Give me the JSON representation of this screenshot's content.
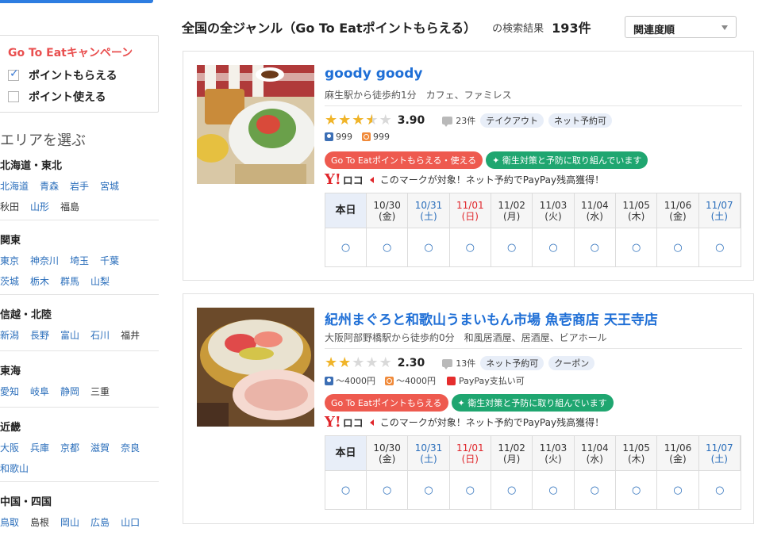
{
  "sidebar": {
    "campaign_title": "Go To Eatキャンペーン",
    "options": [
      {
        "label": "ポイントもらえる",
        "checked": true
      },
      {
        "label": "ポイント使える",
        "checked": false
      }
    ],
    "area_heading": "エリアを選ぶ",
    "regions": [
      {
        "name": "北海道・東北",
        "prefs": [
          {
            "name": "北海道",
            "link": true
          },
          {
            "name": "青森",
            "link": true
          },
          {
            "name": "岩手",
            "link": true
          },
          {
            "name": "宮城",
            "link": true
          },
          {
            "name": "秋田",
            "link": false
          },
          {
            "name": "山形",
            "link": true
          },
          {
            "name": "福島",
            "link": false
          }
        ]
      },
      {
        "name": "関東",
        "prefs": [
          {
            "name": "東京",
            "link": true
          },
          {
            "name": "神奈川",
            "link": true
          },
          {
            "name": "埼玉",
            "link": true
          },
          {
            "name": "千葉",
            "link": true
          },
          {
            "name": "茨城",
            "link": true
          },
          {
            "name": "栃木",
            "link": true
          },
          {
            "name": "群馬",
            "link": true
          },
          {
            "name": "山梨",
            "link": true
          }
        ]
      },
      {
        "name": "信越・北陸",
        "prefs": [
          {
            "name": "新潟",
            "link": true
          },
          {
            "name": "長野",
            "link": true
          },
          {
            "name": "富山",
            "link": true
          },
          {
            "name": "石川",
            "link": true
          },
          {
            "name": "福井",
            "link": false
          }
        ]
      },
      {
        "name": "東海",
        "prefs": [
          {
            "name": "愛知",
            "link": true
          },
          {
            "name": "岐阜",
            "link": true
          },
          {
            "name": "静岡",
            "link": true
          },
          {
            "name": "三重",
            "link": false
          }
        ]
      },
      {
        "name": "近畿",
        "prefs": [
          {
            "name": "大阪",
            "link": true
          },
          {
            "name": "兵庫",
            "link": true
          },
          {
            "name": "京都",
            "link": true
          },
          {
            "name": "滋賀",
            "link": true
          },
          {
            "name": "奈良",
            "link": true
          },
          {
            "name": "和歌山",
            "link": true
          }
        ]
      },
      {
        "name": "中国・四国",
        "prefs": [
          {
            "name": "鳥取",
            "link": true
          },
          {
            "name": "島根",
            "link": false
          },
          {
            "name": "岡山",
            "link": true
          },
          {
            "name": "広島",
            "link": true
          },
          {
            "name": "山口",
            "link": true
          }
        ]
      }
    ]
  },
  "header": {
    "title": "全国の全ジャンル（Go To Eatポイントもらえる）",
    "result_label": "の検索結果",
    "result_count": "193件",
    "sort_value": "関連度順"
  },
  "calendar_header": {
    "today_label": "本日",
    "days": [
      {
        "date": "10/30",
        "dow": "(金)",
        "type": "weekday"
      },
      {
        "date": "10/31",
        "dow": "(土)",
        "type": "sat"
      },
      {
        "date": "11/01",
        "dow": "(日)",
        "type": "sun"
      },
      {
        "date": "11/02",
        "dow": "(月)",
        "type": "weekday"
      },
      {
        "date": "11/03",
        "dow": "(火)",
        "type": "weekday"
      },
      {
        "date": "11/04",
        "dow": "(水)",
        "type": "weekday"
      },
      {
        "date": "11/05",
        "dow": "(木)",
        "type": "weekday"
      },
      {
        "date": "11/06",
        "dow": "(金)",
        "type": "weekday"
      },
      {
        "date": "11/07",
        "dow": "(土)",
        "type": "sat"
      }
    ],
    "availability_mark": "○"
  },
  "promo": {
    "logo_y": "Y!",
    "logo_text": "ロコ",
    "text": "このマークが対象！ネット予約でPayPay残高獲得！"
  },
  "restaurants": [
    {
      "name": "goody goody",
      "meta": "麻生駅から徒歩約1分　カフェ、ファミレス",
      "rating": 3.9,
      "rating_text": "3.90",
      "stars": [
        1,
        1,
        1,
        0.5,
        0
      ],
      "reviews": "23件",
      "tags": [
        "テイクアウト",
        "ネット予約可"
      ],
      "dinner_budget": "999",
      "lunch_budget": "999",
      "paypay": "",
      "badges": [
        {
          "text": "Go To Eatポイントもらえる・使える",
          "color": "red"
        },
        {
          "text": "✦ 衛生対策と予防に取り組んでいます",
          "color": "green"
        }
      ]
    },
    {
      "name": "紀州まぐろと和歌山うまいもん市場 魚壱商店 天王寺店",
      "meta": "大阪阿部野橋駅から徒歩約0分　和風居酒屋、居酒屋、ビアホール",
      "rating": 2.3,
      "rating_text": "2.30",
      "stars": [
        1,
        1,
        0,
        0,
        0
      ],
      "reviews": "13件",
      "tags": [
        "ネット予約可",
        "クーポン"
      ],
      "dinner_budget": "～4000円",
      "lunch_budget": "～4000円",
      "paypay": "PayPay支払い可",
      "badges": [
        {
          "text": "Go To Eatポイントもらえる",
          "color": "red"
        },
        {
          "text": "✦ 衛生対策と予防に取り組んでいます",
          "color": "green"
        }
      ]
    }
  ]
}
